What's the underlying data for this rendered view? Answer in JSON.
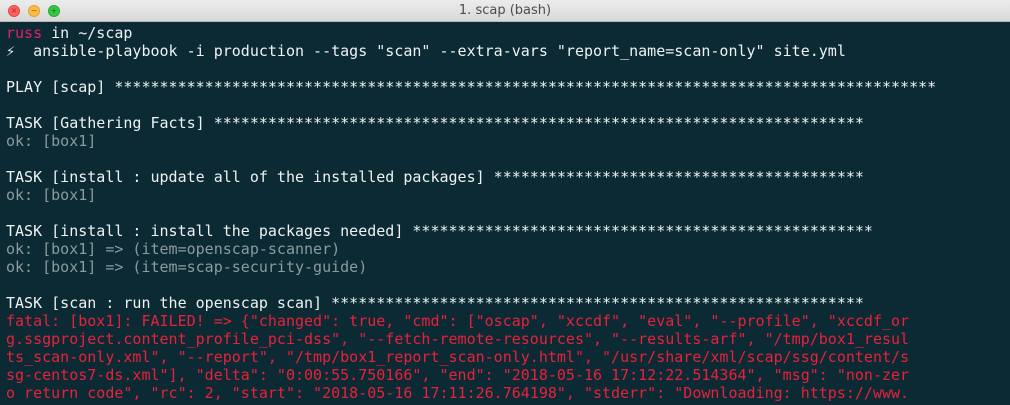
{
  "window": {
    "title": "1. scap (bash)"
  },
  "prompt": {
    "user": "russ",
    "in_text": " in ~/scap",
    "symbol": "⚡",
    "command": "  ansible-playbook -i production --tags \"scan\" --extra-vars \"report_name=scan-only\" site.yml"
  },
  "output": {
    "play": "PLAY [scap] *******************************************************************************************",
    "task_facts": "TASK [Gathering Facts] ************************************************************************",
    "task_facts_ok": "ok: [box1]",
    "task_update": "TASK [install : update all of the installed packages] *****************************************",
    "task_update_ok": "ok: [box1]",
    "task_install": "TASK [install : install the packages needed] ***************************************************",
    "task_install_ok1": "ok: [box1] => (item=openscap-scanner)",
    "task_install_ok2": "ok: [box1] => (item=scap-security-guide)",
    "task_scan": "TASK [scan : run the openscap scan] ***********************************************************",
    "fatal": [
      "fatal: [box1]: FAILED! => {\"changed\": true, \"cmd\": [\"oscap\", \"xccdf\", \"eval\", \"--profile\", \"xccdf_or",
      "g.ssgproject.content_profile_pci-dss\", \"--fetch-remote-resources\", \"--results-arf\", \"/tmp/box1_resul",
      "ts_scan-only.xml\", \"--report\", \"/tmp/box1_report_scan-only.html\", \"/usr/share/xml/scap/ssg/content/s",
      "sg-centos7-ds.xml\"], \"delta\": \"0:00:55.750166\", \"end\": \"2018-05-16 17:12:22.514364\", \"msg\": \"non-zer",
      "o return code\", \"rc\": 2, \"start\": \"2018-05-16 17:11:26.764198\", \"stderr\": \"Downloading: https://www."
    ]
  },
  "colors": {
    "background": "#0b2a33",
    "user": "#e0206a",
    "ok": "#8b9b9e",
    "fatal": "#e8213b"
  }
}
